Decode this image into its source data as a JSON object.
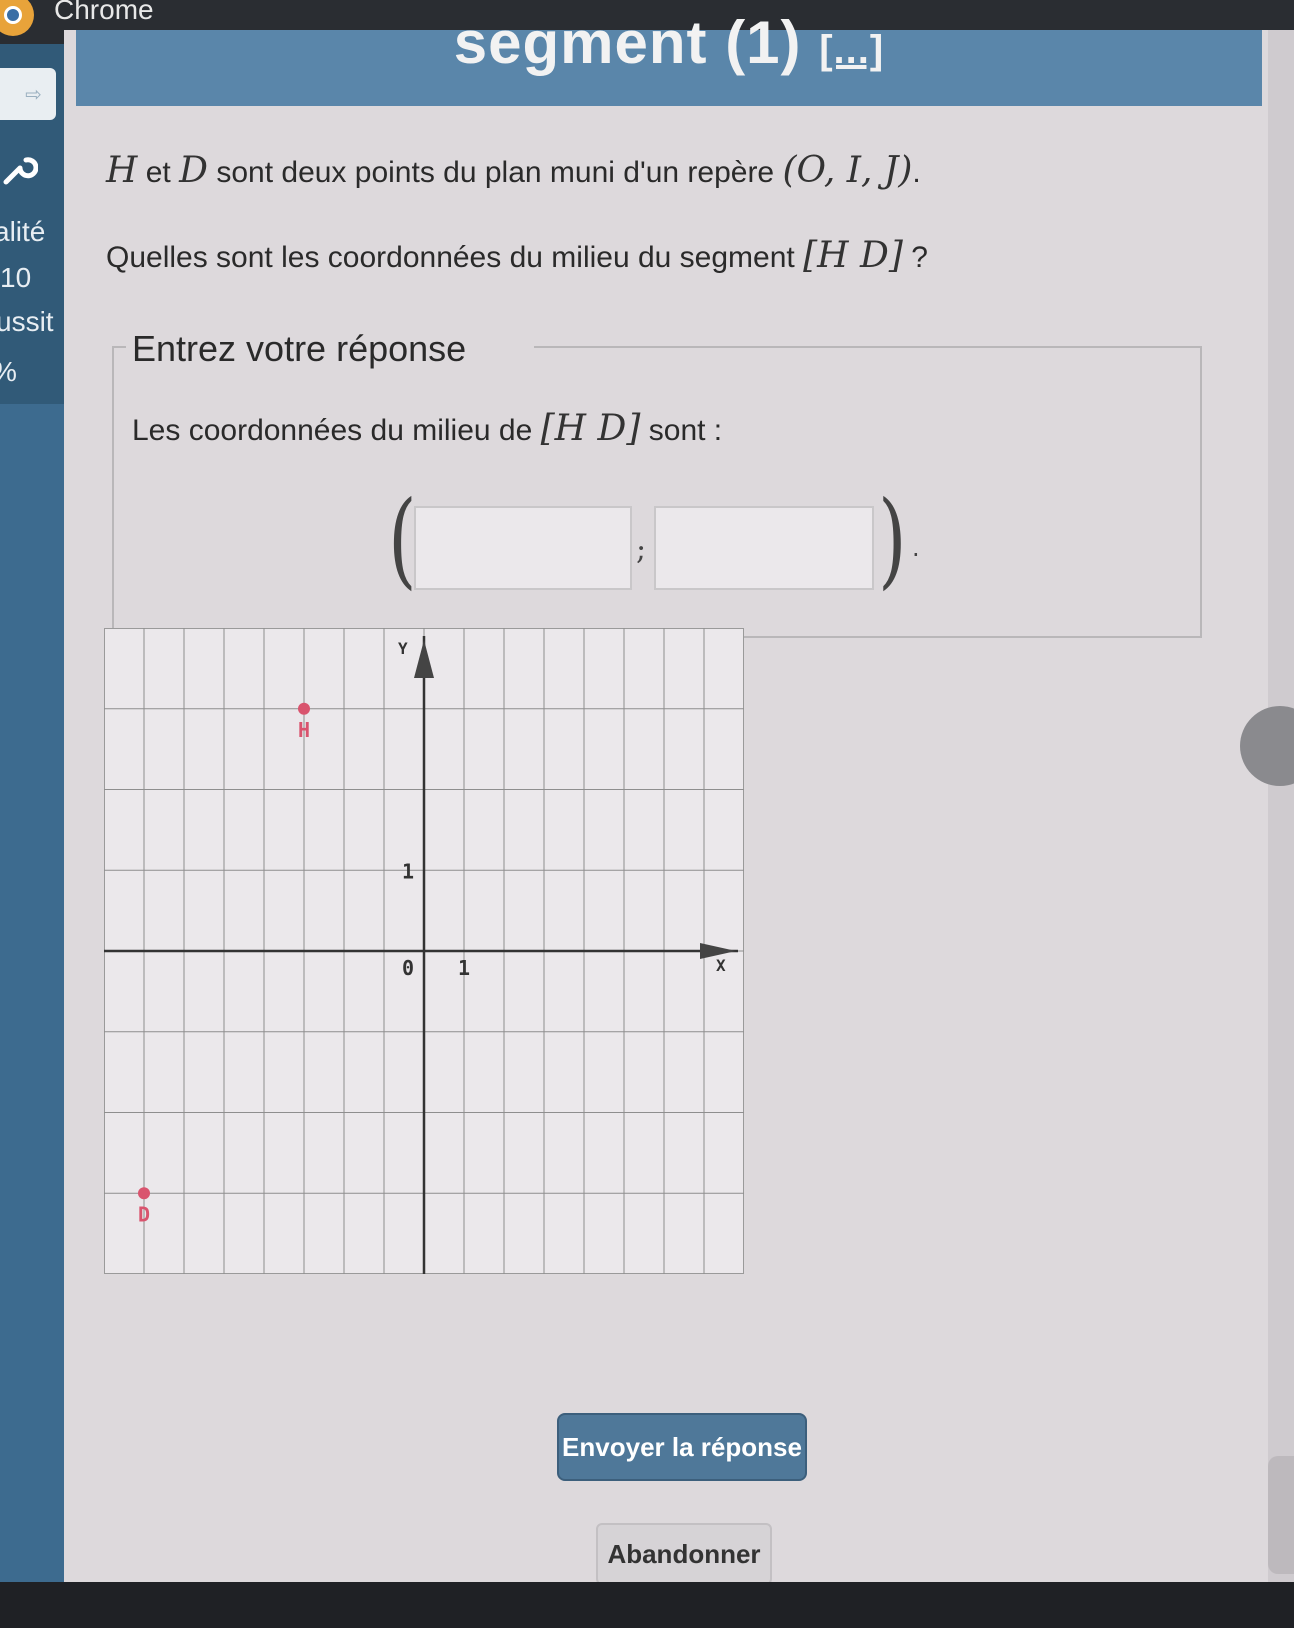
{
  "browser": {
    "title": "Chrome"
  },
  "sidebar": {
    "back_label": "⇨",
    "items": [
      {
        "label": "alité"
      },
      {
        "label": "10"
      },
      {
        "label": "ussit"
      },
      {
        "label": "%"
      }
    ]
  },
  "header": {
    "title": "segment (1)",
    "link": "[...]"
  },
  "question": {
    "line1_point1": "H",
    "line1_et": "et",
    "line1_point2": "D",
    "line1_text": "sont deux points du plan muni d'un repère",
    "line1_frame": "(O, I, J)",
    "line1_end": ".",
    "line2_text": "Quelles sont les coordonnées du milieu du segment",
    "line2_segment": "[H D]",
    "line2_end": "?"
  },
  "answer": {
    "legend": "Entrez votre réponse",
    "intro_text": "Les coordonnées du milieu de",
    "intro_segment": "[H D]",
    "intro_end": "sont :",
    "open_paren": "(",
    "separator": ";",
    "close_paren": ")",
    "end_dot": ".",
    "x_value": "",
    "y_value": ""
  },
  "graph": {
    "axis_x_label": "X",
    "axis_y_label": "Y",
    "origin_label": "0",
    "x_unit_label": "1",
    "y_unit_label": "1",
    "points": [
      {
        "name": "H",
        "x": -3,
        "y": 3,
        "color": "#d9546e"
      },
      {
        "name": "D",
        "x": -7,
        "y": -3,
        "color": "#d9546e"
      }
    ],
    "x_range": [
      -8,
      8
    ],
    "y_range": [
      -4,
      4
    ]
  },
  "buttons": {
    "send_label": "Envoyer la réponse",
    "cancel_label": "Abandonner"
  }
}
